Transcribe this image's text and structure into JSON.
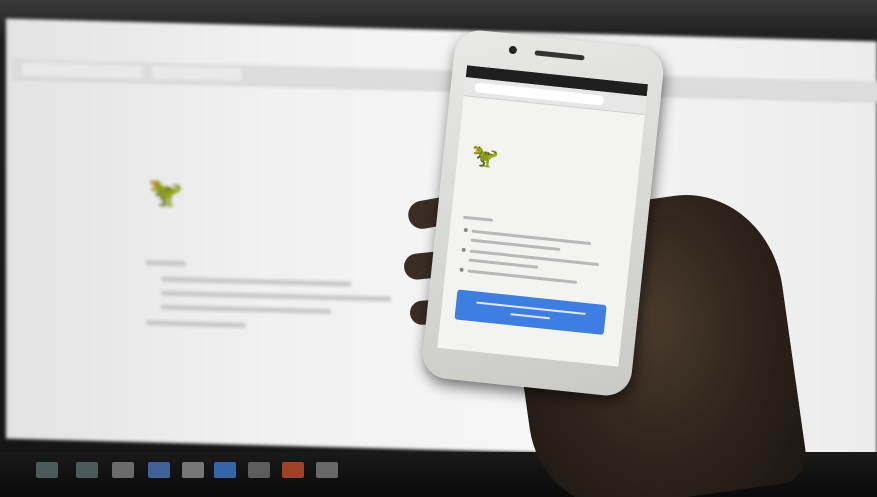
{
  "scene": {
    "description_type": "photo",
    "monitor": {
      "heading_text": "",
      "icon": "dinosaur-icon"
    },
    "phone": {
      "heading_text": "",
      "icon": "dinosaur-icon",
      "button_color": "#3d7ee0"
    }
  }
}
